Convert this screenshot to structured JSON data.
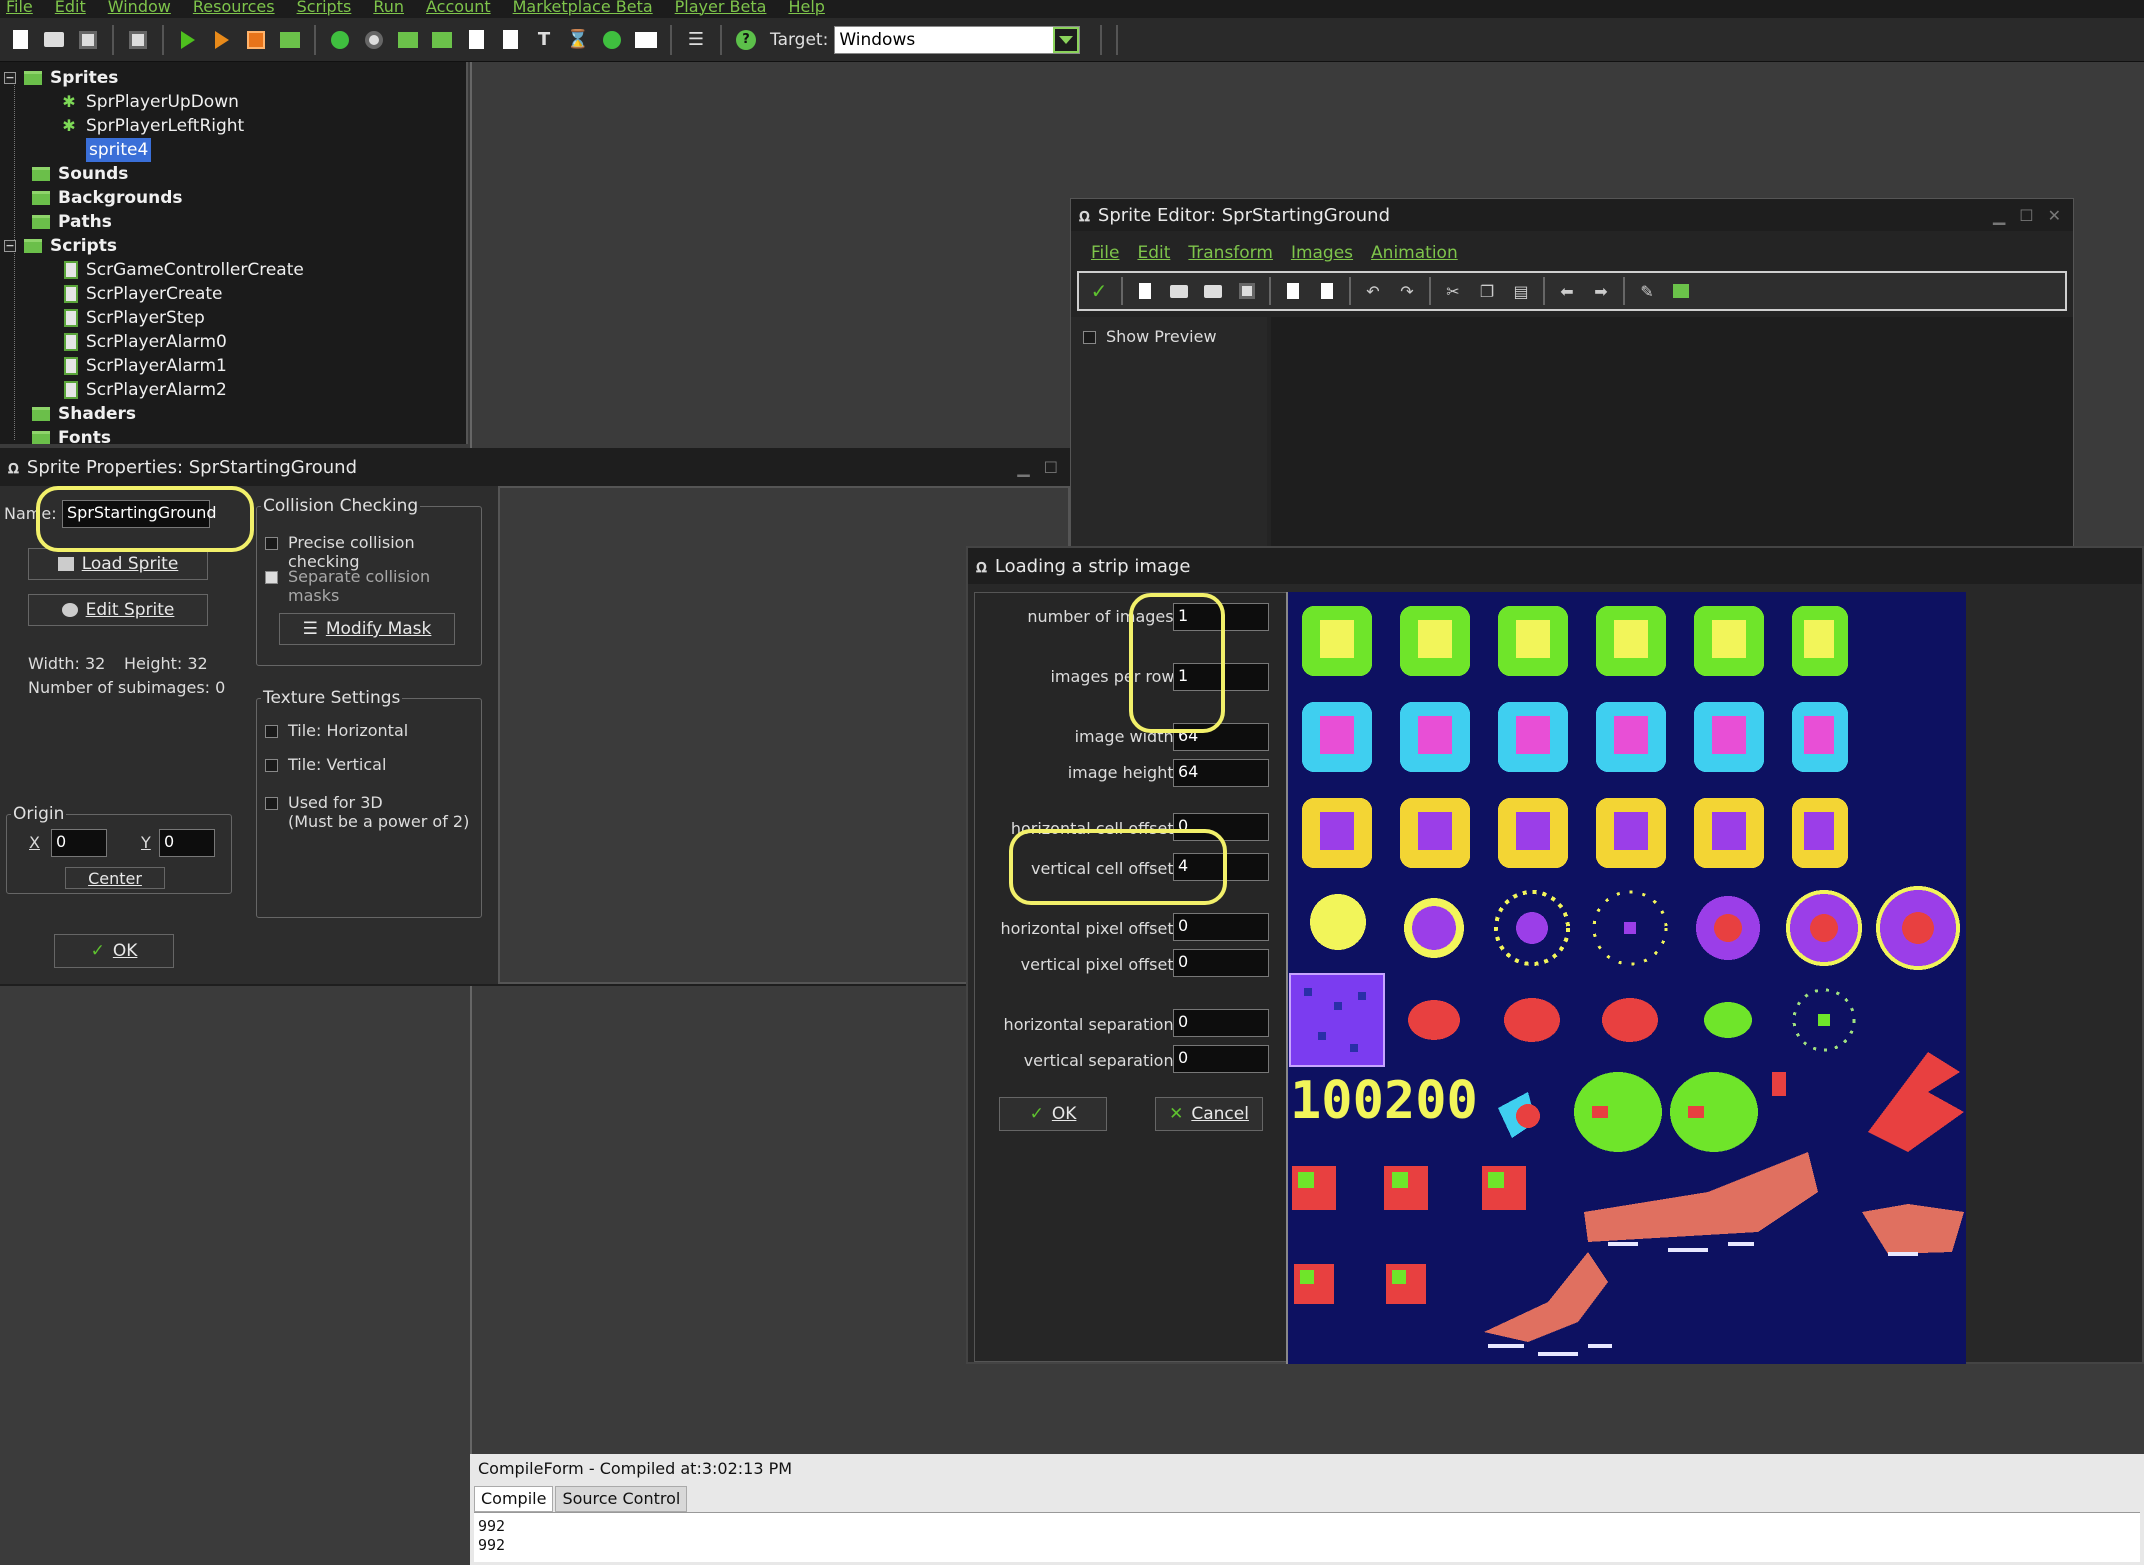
{
  "menubar": [
    "File",
    "Edit",
    "Window",
    "Resources",
    "Scripts",
    "Run",
    "Account",
    "Marketplace Beta",
    "Player Beta",
    "Help"
  ],
  "toolbar": {
    "target_label": "Target:",
    "target_value": "Windows"
  },
  "tree": {
    "sprites": "Sprites",
    "sprite_items": [
      "SprPlayerUpDown",
      "SprPlayerLeftRight",
      "sprite4"
    ],
    "sounds": "Sounds",
    "backgrounds": "Backgrounds",
    "paths": "Paths",
    "scripts": "Scripts",
    "script_items": [
      "ScrGameControllerCreate",
      "ScrPlayerCreate",
      "ScrPlayerStep",
      "ScrPlayerAlarm0",
      "ScrPlayerAlarm1",
      "ScrPlayerAlarm2"
    ],
    "shaders": "Shaders",
    "fonts": "Fonts"
  },
  "sprite_props": {
    "title": "Sprite Properties: SprStartingGround",
    "name_label": "Name:",
    "name_value": "SprStartingGround",
    "load_sprite": "Load Sprite",
    "edit_sprite": "Edit Sprite",
    "width_text": "Width: 32",
    "height_text": "Height: 32",
    "subimages_text": "Number of subimages: 0",
    "origin_title": "Origin",
    "origin_x_label": "X",
    "origin_x": "0",
    "origin_y_label": "Y",
    "origin_y": "0",
    "center": "Center",
    "ok": "OK",
    "collision_title": "Collision Checking",
    "precise": "Precise collision checking",
    "separate": "Separate collision masks",
    "modify_mask": "Modify Mask",
    "texture_title": "Texture Settings",
    "tile_h": "Tile: Horizontal",
    "tile_v": "Tile: Vertical",
    "used_3d": "Used for 3D",
    "used_3d_note": "(Must be a power of 2)"
  },
  "sprite_editor": {
    "title": "Sprite Editor: SprStartingGround",
    "menu": [
      "File",
      "Edit",
      "Transform",
      "Images",
      "Animation"
    ],
    "show_preview": "Show Preview"
  },
  "strip": {
    "title": "Loading a strip image",
    "fields": [
      {
        "label": "number of images:",
        "value": "1"
      },
      {
        "label": "images per row:",
        "value": "1"
      },
      {
        "label": "image width:",
        "value": "64"
      },
      {
        "label": "image height:",
        "value": "64"
      },
      {
        "label": "horizontal cell offset:",
        "value": "0"
      },
      {
        "label": "vertical cell offset:",
        "value": "4"
      },
      {
        "label": "horizontal pixel offset:",
        "value": "0"
      },
      {
        "label": "vertical pixel offset:",
        "value": "0"
      },
      {
        "label": "horizontal separation:",
        "value": "0"
      },
      {
        "label": "vertical separation:",
        "value": "0"
      }
    ],
    "ok": "OK",
    "cancel": "Cancel",
    "preview_text": "100200"
  },
  "compile": {
    "header": "CompileForm - Compiled at:3:02:13 PM",
    "tabs": [
      "Compile",
      "Source Control"
    ],
    "lines": [
      "992",
      "992"
    ]
  },
  "colors": {
    "menu_accent": "#7ec44b",
    "highlight": "#f2f06a",
    "preview_bg": "#0d1161"
  }
}
